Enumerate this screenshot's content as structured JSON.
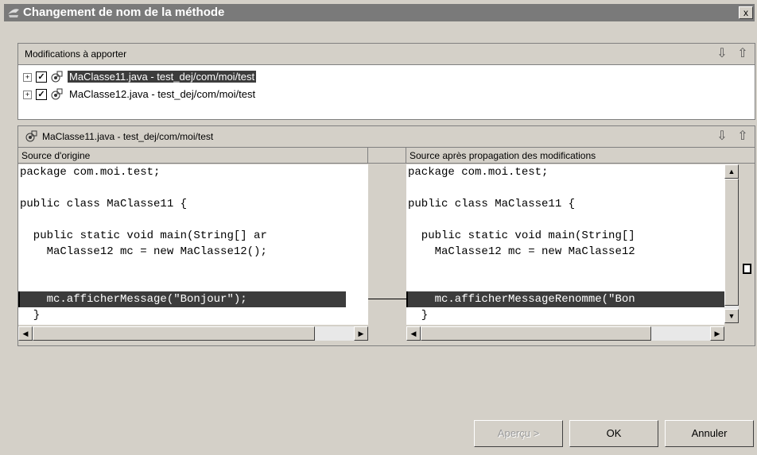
{
  "window": {
    "title": "Changement de nom de la méthode",
    "close_label": "x"
  },
  "changes_panel": {
    "title": "Modifications à apporter",
    "items": [
      {
        "label": "MaClasse11.java - test_dej/com/moi/test",
        "checked": true,
        "selected": true
      },
      {
        "label": "MaClasse12.java - test_dej/com/moi/test",
        "checked": true,
        "selected": false
      }
    ]
  },
  "compare_panel": {
    "title": "MaClasse11.java - test_dej/com/moi/test",
    "left_header": "Source d'origine",
    "right_header": "Source après propagation des modifications",
    "left_lines": [
      "package com.moi.test;",
      "",
      "public class MaClasse11 {",
      "",
      "  public static void main(String[] ar",
      "    MaClasse12 mc = new MaClasse12();",
      "    mc.afficherMessage(\"Bonjour\");",
      "  }"
    ],
    "right_lines": [
      "package com.moi.test;",
      "",
      "public class MaClasse11 {",
      "",
      "  public static void main(String[]",
      "    MaClasse12 mc = new MaClasse12",
      "    mc.afficherMessageRenomme(\"Bon",
      "  }"
    ],
    "highlighted_line": 6
  },
  "buttons": {
    "preview": "Aperçu >",
    "ok": "OK",
    "cancel": "Annuler"
  },
  "icons": {
    "down": "down-arrow-icon",
    "up": "up-arrow-icon",
    "java_file": "java-file-icon",
    "app": "app-icon"
  }
}
